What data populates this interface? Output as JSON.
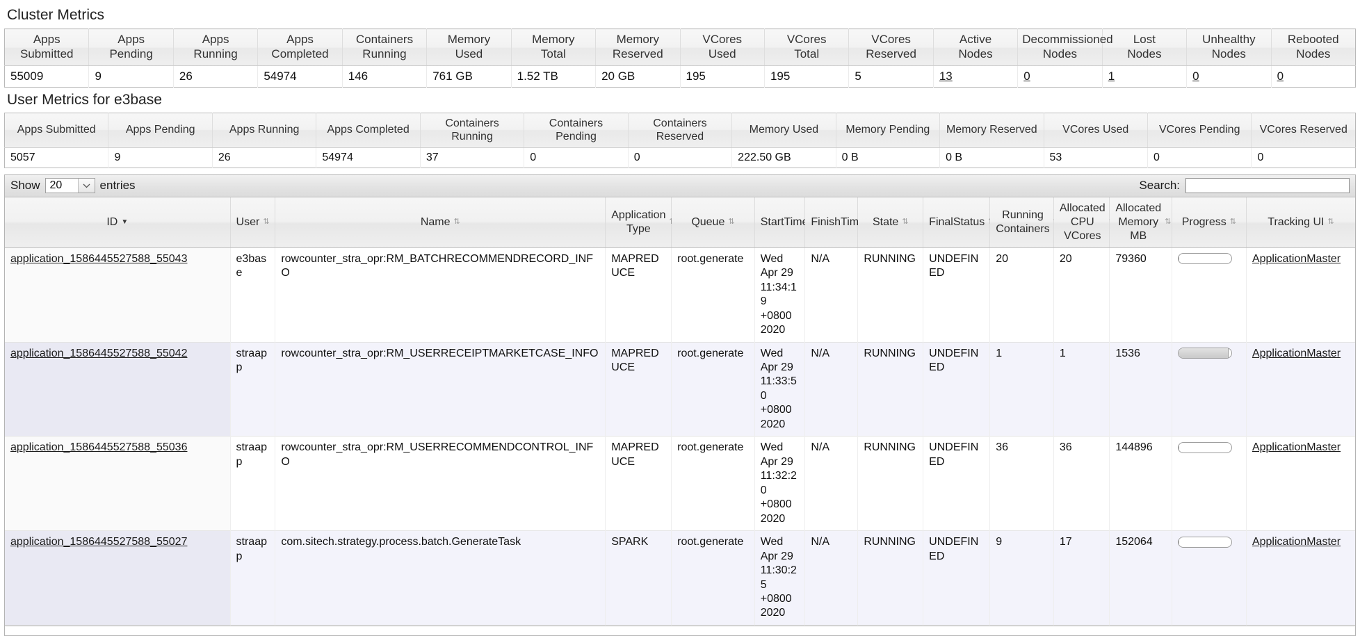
{
  "cluster_metrics": {
    "title": "Cluster Metrics",
    "headers": [
      "Apps\nSubmitted",
      "Apps\nPending",
      "Apps\nRunning",
      "Apps\nCompleted",
      "Containers\nRunning",
      "Memory\nUsed",
      "Memory\nTotal",
      "Memory\nReserved",
      "VCores\nUsed",
      "VCores\nTotal",
      "VCores\nReserved",
      "Active\nNodes",
      "Decommissioned\nNodes",
      "Lost\nNodes",
      "Unhealthy\nNodes",
      "Rebooted\nNodes"
    ],
    "values": [
      "55009",
      "9",
      "26",
      "54974",
      "146",
      "761 GB",
      "1.52 TB",
      "20 GB",
      "195",
      "195",
      "5",
      "13",
      "0",
      "1",
      "0",
      "0"
    ],
    "link_cells": [
      11,
      12,
      13,
      14,
      15
    ]
  },
  "user_metrics": {
    "title": "User Metrics for e3base",
    "headers": [
      "Apps Submitted",
      "Apps Pending",
      "Apps Running",
      "Apps Completed",
      "Containers Running",
      "Containers Pending",
      "Containers Reserved",
      "Memory Used",
      "Memory Pending",
      "Memory Reserved",
      "VCores Used",
      "VCores Pending",
      "VCores Reserved"
    ],
    "values": [
      "5057",
      "9",
      "26",
      "54974",
      "37",
      "0",
      "0",
      "222.50 GB",
      "0 B",
      "0 B",
      "53",
      "0",
      "0"
    ]
  },
  "toolbar": {
    "show_label": "Show",
    "entries_value": "20",
    "entries_label": "entries",
    "dropdown_icon": "chevron-down-icon",
    "search_label": "Search:",
    "search_value": "",
    "search_placeholder": ""
  },
  "apps_table": {
    "columns": [
      {
        "label": "ID",
        "sort": "desc"
      },
      {
        "label": "User",
        "sort": "none"
      },
      {
        "label": "Name",
        "sort": "none"
      },
      {
        "label": "Application\nType",
        "sort": "none"
      },
      {
        "label": "Queue",
        "sort": "none"
      },
      {
        "label": "StartTime",
        "sort": "none"
      },
      {
        "label": "FinishTime",
        "sort": "none"
      },
      {
        "label": "State",
        "sort": "none"
      },
      {
        "label": "FinalStatus",
        "sort": "none"
      },
      {
        "label": "Running\nContainers",
        "sort": "none"
      },
      {
        "label": "Allocated\nCPU\nVCores",
        "sort": "none"
      },
      {
        "label": "Allocated\nMemory\nMB",
        "sort": "none"
      },
      {
        "label": "Progress",
        "sort": "none"
      },
      {
        "label": "Tracking UI",
        "sort": "none"
      }
    ],
    "rows": [
      {
        "id": "application_1586445527588_55043",
        "user": "e3base",
        "name": "rowcounter_stra_opr:RM_BATCHRECOMMENDRECORD_INFO",
        "app_type": "MAPREDUCE",
        "queue": "root.generate",
        "start_time": "Wed Apr 29 11:34:19 +0800 2020",
        "finish_time": "N/A",
        "state": "RUNNING",
        "final_status": "UNDEFINED",
        "running_containers": "20",
        "allocated_cpu_vcores": "20",
        "allocated_memory_mb": "79360",
        "progress": 0,
        "tracking_ui": "ApplicationMaster"
      },
      {
        "id": "application_1586445527588_55042",
        "user": "straapp",
        "name": "rowcounter_stra_opr:RM_USERRECEIPTMARKETCASE_INFO",
        "app_type": "MAPREDUCE",
        "queue": "root.generate",
        "start_time": "Wed Apr 29 11:33:50 +0800 2020",
        "finish_time": "N/A",
        "state": "RUNNING",
        "final_status": "UNDEFINED",
        "running_containers": "1",
        "allocated_cpu_vcores": "1",
        "allocated_memory_mb": "1536",
        "progress": 95,
        "tracking_ui": "ApplicationMaster"
      },
      {
        "id": "application_1586445527588_55036",
        "user": "straapp",
        "name": "rowcounter_stra_opr:RM_USERRECOMMENDCONTROL_INFO",
        "app_type": "MAPREDUCE",
        "queue": "root.generate",
        "start_time": "Wed Apr 29 11:32:20 +0800 2020",
        "finish_time": "N/A",
        "state": "RUNNING",
        "final_status": "UNDEFINED",
        "running_containers": "36",
        "allocated_cpu_vcores": "36",
        "allocated_memory_mb": "144896",
        "progress": 0,
        "tracking_ui": "ApplicationMaster"
      },
      {
        "id": "application_1586445527588_55027",
        "user": "straapp",
        "name": "com.sitech.strategy.process.batch.GenerateTask",
        "app_type": "SPARK",
        "queue": "root.generate",
        "start_time": "Wed Apr 29 11:30:25 +0800 2020",
        "finish_time": "N/A",
        "state": "RUNNING",
        "final_status": "UNDEFINED",
        "running_containers": "9",
        "allocated_cpu_vcores": "17",
        "allocated_memory_mb": "152064",
        "progress": 0,
        "tracking_ui": "ApplicationMaster"
      }
    ]
  }
}
